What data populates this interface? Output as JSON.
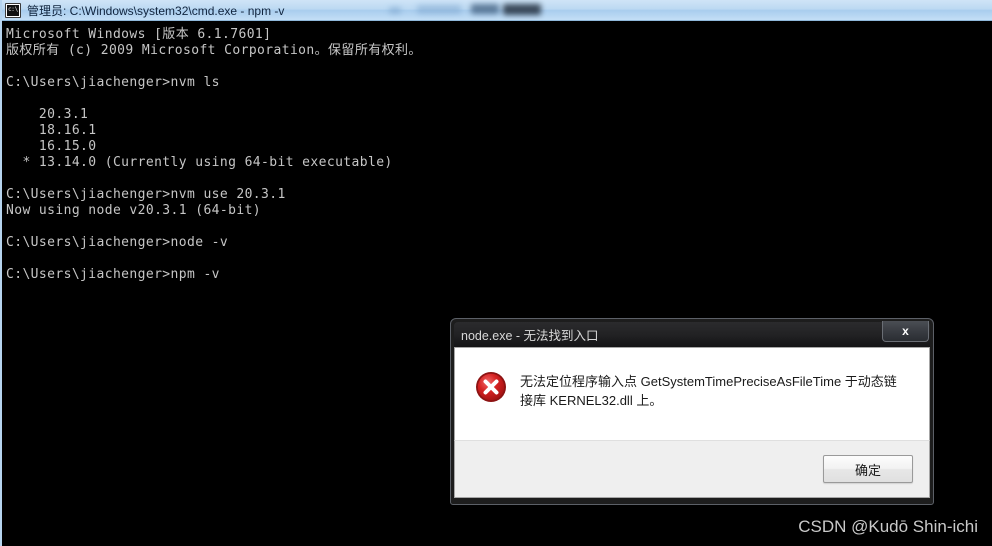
{
  "window": {
    "title": "管理员: C:\\Windows\\system32\\cmd.exe - npm  -v",
    "icon": "cmd-console-icon"
  },
  "terminal": {
    "lines": [
      "Microsoft Windows [版本 6.1.7601]",
      "版权所有 (c) 2009 Microsoft Corporation。保留所有权利。",
      "",
      "C:\\Users\\jiachenger>nvm ls",
      "",
      "    20.3.1",
      "    18.16.1",
      "    16.15.0",
      "  * 13.14.0 (Currently using 64-bit executable)",
      "",
      "C:\\Users\\jiachenger>nvm use 20.3.1",
      "Now using node v20.3.1 (64-bit)",
      "",
      "C:\\Users\\jiachenger>node -v",
      "",
      "C:\\Users\\jiachenger>npm -v"
    ]
  },
  "dialog": {
    "title": "node.exe - 无法找到入口",
    "close_label": "x",
    "icon": "error-x-icon",
    "message": "无法定位程序输入点 GetSystemTimePreciseAsFileTime 于动态链接库 KERNEL32.dll 上。",
    "ok_label": "确定"
  },
  "watermark": {
    "text": "CSDN @Kudō Shin-ichi"
  },
  "colors": {
    "console_bg": "#000000",
    "console_text": "#c6c6c6",
    "titlebar_blue": "#bcd9f2",
    "dialog_titlebar": "#222224",
    "dialog_body": "#ffffff",
    "dialog_footer": "#efefef",
    "error_red": "#cf1b1b",
    "watermark_gray": "#c9c9c9"
  }
}
